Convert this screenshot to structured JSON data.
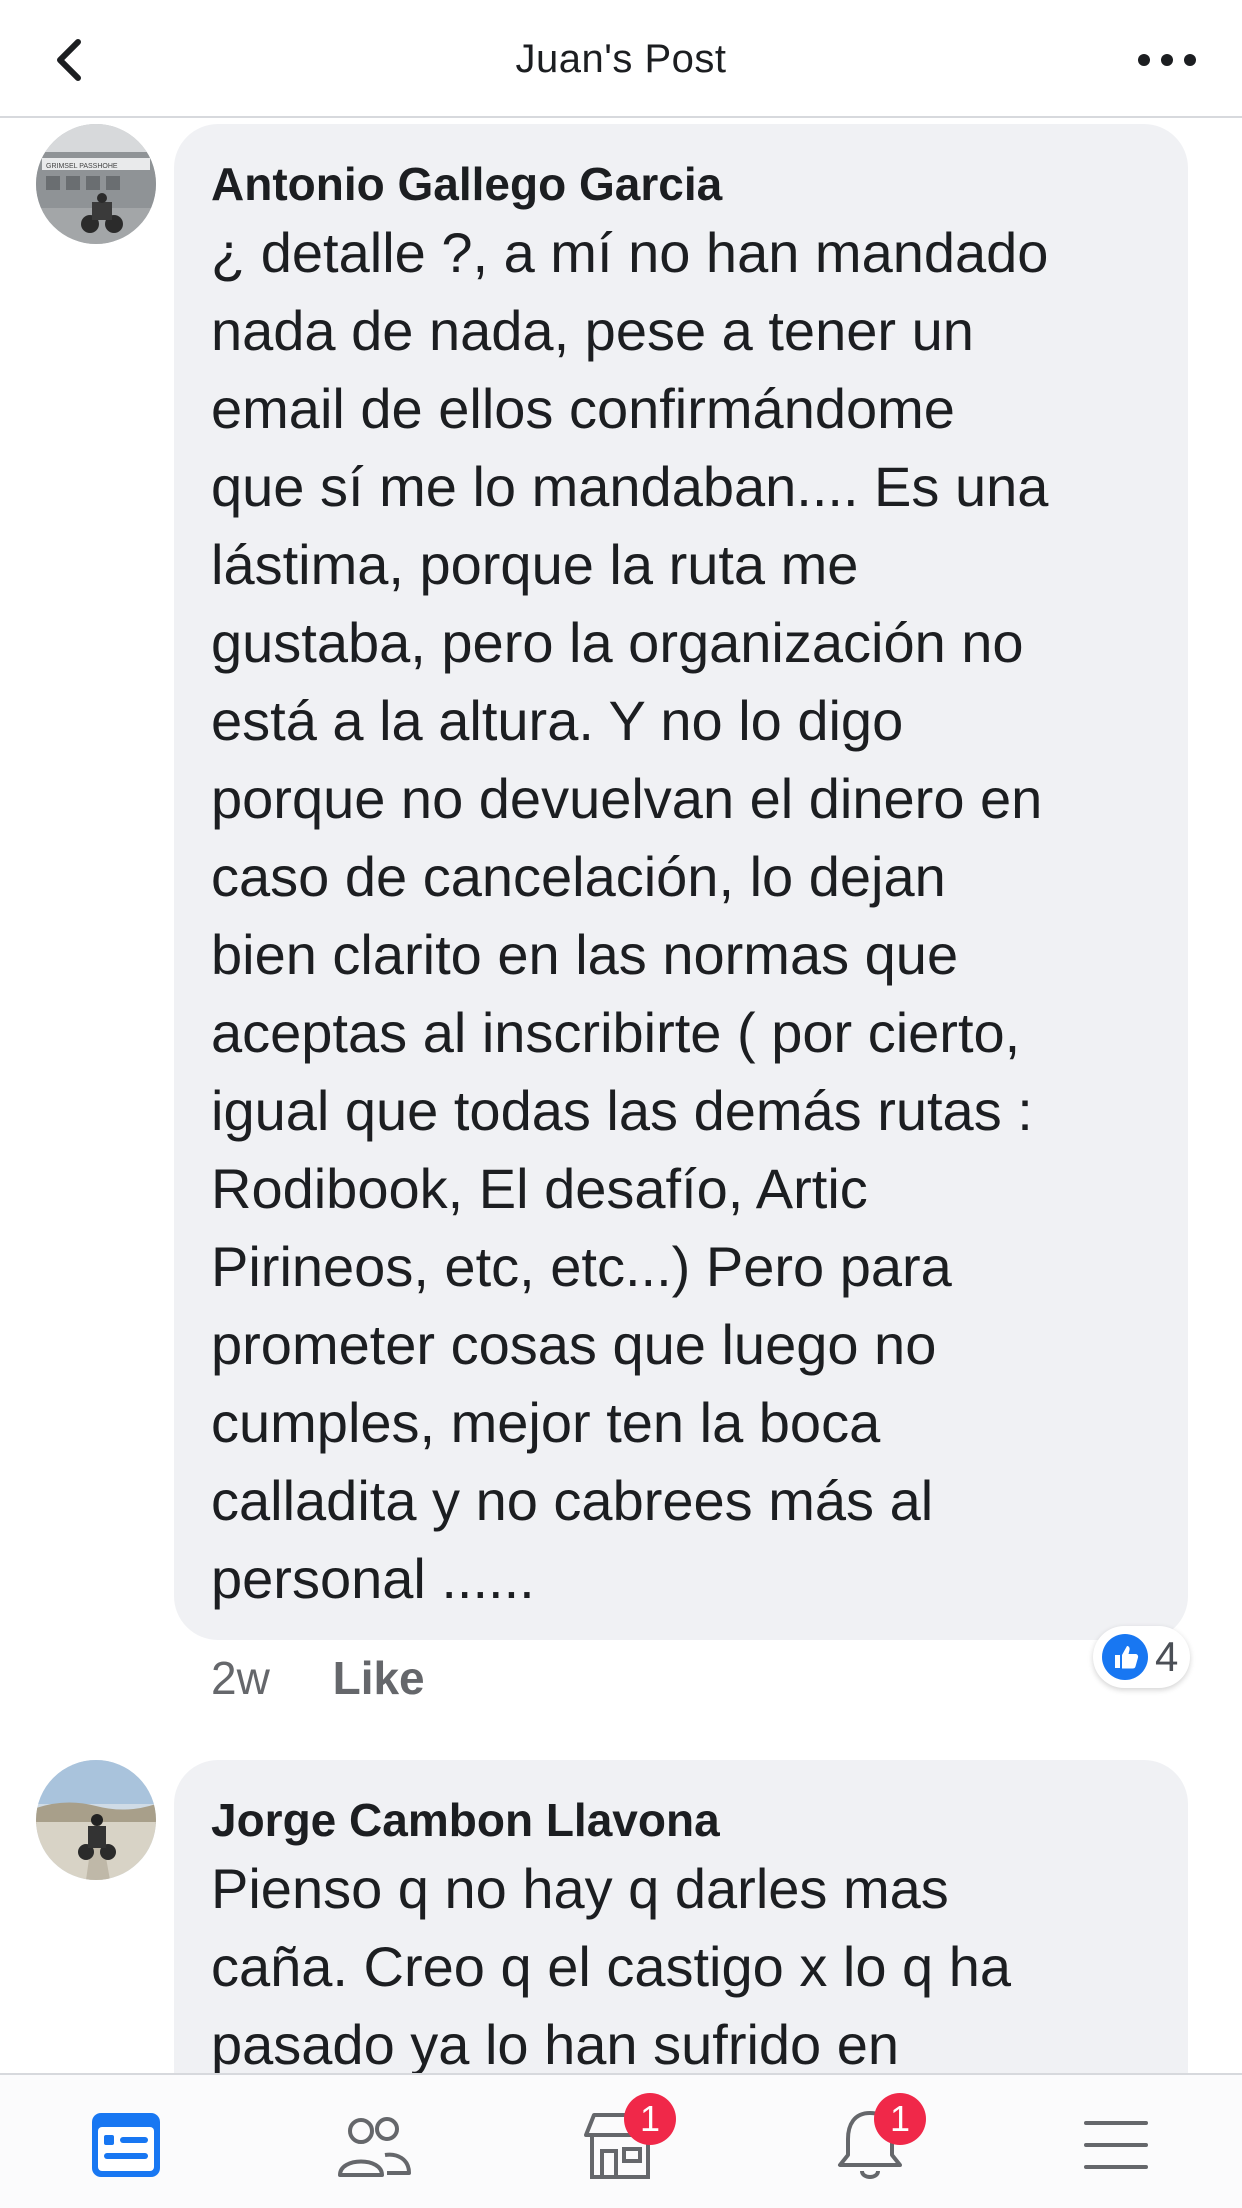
{
  "header": {
    "title": "Juan's Post",
    "back_icon": "chevron-left-icon",
    "more_icon": "more-horizontal-icon"
  },
  "comments": [
    {
      "author": "Antonio Gallego Garcia",
      "avatar_sign_text": "GRIMSEL PASSHOHE",
      "text": "¿ detalle ?, a mí no han mandado\nnada de nada, pese a tener un\nemail de ellos confirmándome\nque sí me lo mandaban....  Es una\nlástima, porque la ruta me\ngustaba, pero la organización no\nestá a la altura. Y no lo digo\nporque no devuelvan el dinero en\ncaso de cancelación,  lo dejan\nbien clarito en las normas que\naceptas al inscribirte ( por cierto,\nigual que todas las demás rutas :\nRodibook, El desafío, Artic\nPirineos, etc, etc...)  Pero para\nprometer cosas que luego no\ncumples, mejor ten la boca\ncalladita y no cabrees más al\npersonal ......",
      "time": "2w",
      "like_label": "Like",
      "reaction_count": "4",
      "reaction_icon": "thumbs-up-icon"
    },
    {
      "author": "Jorge Cambon Llavona",
      "text": "Pienso q no hay q darles mas\ncaña. Creo q el castigo x lo q ha\npasado ya lo han sufrido en"
    }
  ],
  "bottom_nav": [
    {
      "icon": "news-feed-icon",
      "active": true
    },
    {
      "icon": "friends-icon"
    },
    {
      "icon": "marketplace-icon",
      "badge": "1"
    },
    {
      "icon": "bell-icon",
      "badge": "1"
    },
    {
      "icon": "menu-icon"
    }
  ],
  "colors": {
    "accent": "#1877f2",
    "badge": "#f02849",
    "bubble": "#f0f1f4",
    "muted": "#65676b"
  }
}
